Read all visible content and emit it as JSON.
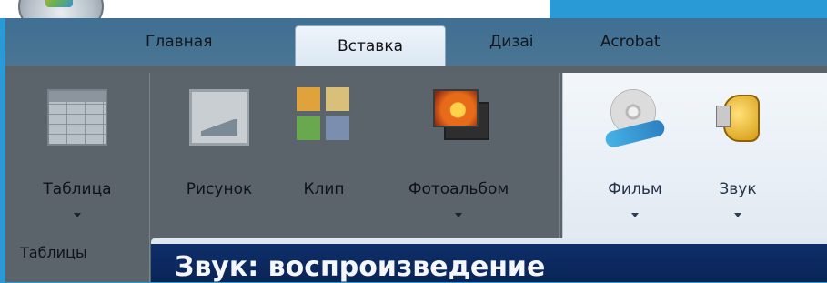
{
  "tabs": [
    {
      "label": "Главная"
    },
    {
      "label": "Вставка",
      "active": true
    },
    {
      "label": "Дизаі"
    },
    {
      "label": "Acrobat"
    }
  ],
  "groups": {
    "tables": {
      "label": "Таблицы",
      "buttons": [
        {
          "label": "Таблица",
          "icon": "table-icon",
          "dropdown": true
        }
      ]
    },
    "illustrations": {
      "buttons": [
        {
          "label": "Рисунок",
          "icon": "picture-icon",
          "dropdown": false
        },
        {
          "label": "Клип",
          "icon": "clipart-icon",
          "dropdown": false
        },
        {
          "label": "Фотоальбом",
          "icon": "photo-album-icon",
          "dropdown": true
        }
      ]
    },
    "media": {
      "buttons": [
        {
          "label": "Фильм",
          "icon": "film-reel-icon",
          "dropdown": true
        },
        {
          "label": "Звук",
          "icon": "speaker-icon",
          "dropdown": true
        }
      ]
    }
  },
  "dialog": {
    "title": "Звук: воспроизведение"
  },
  "colors": {
    "background": "#2a9ad6",
    "ribbon_dark": "#5c646b",
    "dialog_title_bar": "#0e2f6a"
  }
}
